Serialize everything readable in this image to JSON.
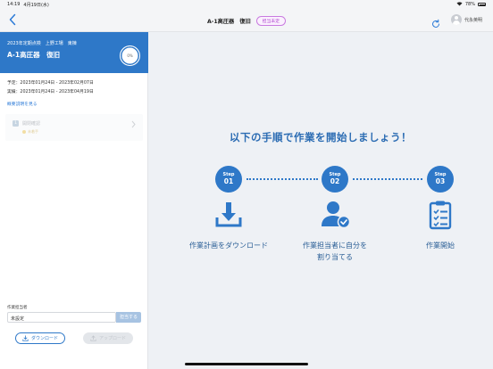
{
  "status_bar": {
    "time": "14:19",
    "date": "4月19日(水)",
    "battery": "78%"
  },
  "header": {
    "title": "A-1高圧器　復旧",
    "badge": "担当未定",
    "user_name": "代永英明",
    "back_icon": "chevron-left-icon",
    "refresh_icon": "refresh-icon"
  },
  "sidebar": {
    "plan": {
      "category": "2023年定期点検",
      "location": "上野工場　東棟",
      "title": "A-1高圧器　復旧",
      "progress_label": "0%"
    },
    "schedule": {
      "planned": "予定：2023年01月24日 - 2023年02月07日",
      "actual": "実績：2023年01月24日 - 2023年04月19日"
    },
    "summary_link": "概要説明を見る",
    "steps": [
      {
        "num": "1",
        "name": "開閉確認",
        "status": "未着手"
      }
    ],
    "assignee": {
      "label": "作業担当者",
      "value": "未設定",
      "assign_button": "担当する"
    },
    "download_button": "ダウンロード",
    "upload_button": "アップロード"
  },
  "main": {
    "headline": "以下の手順で作業を開始しましょう！",
    "steps": [
      {
        "label": "Step",
        "num": "01",
        "text_line1": "作業計画をダウンロード",
        "text_line2": "",
        "icon": "download-icon"
      },
      {
        "label": "Step",
        "num": "02",
        "text_line1": "作業担当者に自分を",
        "text_line2": "割り当てる",
        "icon": "user-check-icon"
      },
      {
        "label": "Step",
        "num": "03",
        "text_line1": "作業開始",
        "text_line2": "",
        "icon": "clipboard-checklist-icon"
      }
    ]
  },
  "colors": {
    "accent": "#2e78c8",
    "headline": "#2b6cb3",
    "badge": "#b14bd1"
  }
}
